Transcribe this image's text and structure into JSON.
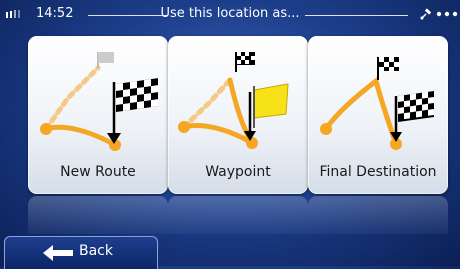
{
  "status": {
    "time": "14:52",
    "title": "Use this location as...",
    "signal_icon": "signal-bars-icon",
    "satellite_icon": "satellite-icon",
    "menu_icon": "dots-icon"
  },
  "options": [
    {
      "label": "New Route",
      "icon": "new-route-icon"
    },
    {
      "label": "Waypoint",
      "icon": "waypoint-icon"
    },
    {
      "label": "Final Destination",
      "icon": "final-destination-icon"
    }
  ],
  "back_button": {
    "label": "Back",
    "icon": "back-arrow-icon"
  },
  "colors": {
    "route": "#f5a623",
    "background": "#1d3f8c",
    "tile": "#eef2f7"
  }
}
